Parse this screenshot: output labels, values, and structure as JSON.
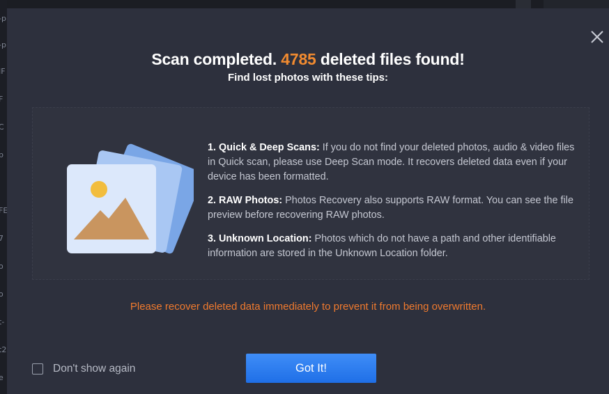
{
  "background": {
    "edge_fragments": [
      "-p",
      "-p",
      "IF",
      "F",
      "C",
      "p",
      "FE",
      "7",
      "o",
      "o",
      "t-",
      "t2",
      "e"
    ]
  },
  "dialog": {
    "close_icon": "close-icon",
    "title_prefix": "Scan completed. ",
    "found_count": "4785",
    "title_suffix": " deleted files found!",
    "subtitle": "Find lost photos with these tips:",
    "illustration_icon": "photos-stack-icon",
    "tips": [
      {
        "heading": "1. Quick & Deep Scans:",
        "body": " If you do not find your deleted photos, audio & video files in Quick scan, please use Deep Scan mode. It recovers deleted data even if your device has been formatted."
      },
      {
        "heading": "2. RAW Photos:",
        "body": " Photos Recovery also supports RAW format. You can see the file preview before recovering RAW photos."
      },
      {
        "heading": "3. Unknown Location:",
        "body": " Photos which do not have a path and other identifiable information are stored in the Unknown Location folder."
      }
    ],
    "warning": "Please recover deleted data immediately to prevent it from being overwritten.",
    "dont_show_label": "Don't show again",
    "dont_show_checked": false,
    "got_it_label": "Got It!"
  },
  "colors": {
    "dialog_bg": "#2d303d",
    "accent_orange": "#f28b30",
    "button_blue": "#2f7ef0",
    "text_white": "#ffffff",
    "text_muted": "#c5c8d2"
  }
}
